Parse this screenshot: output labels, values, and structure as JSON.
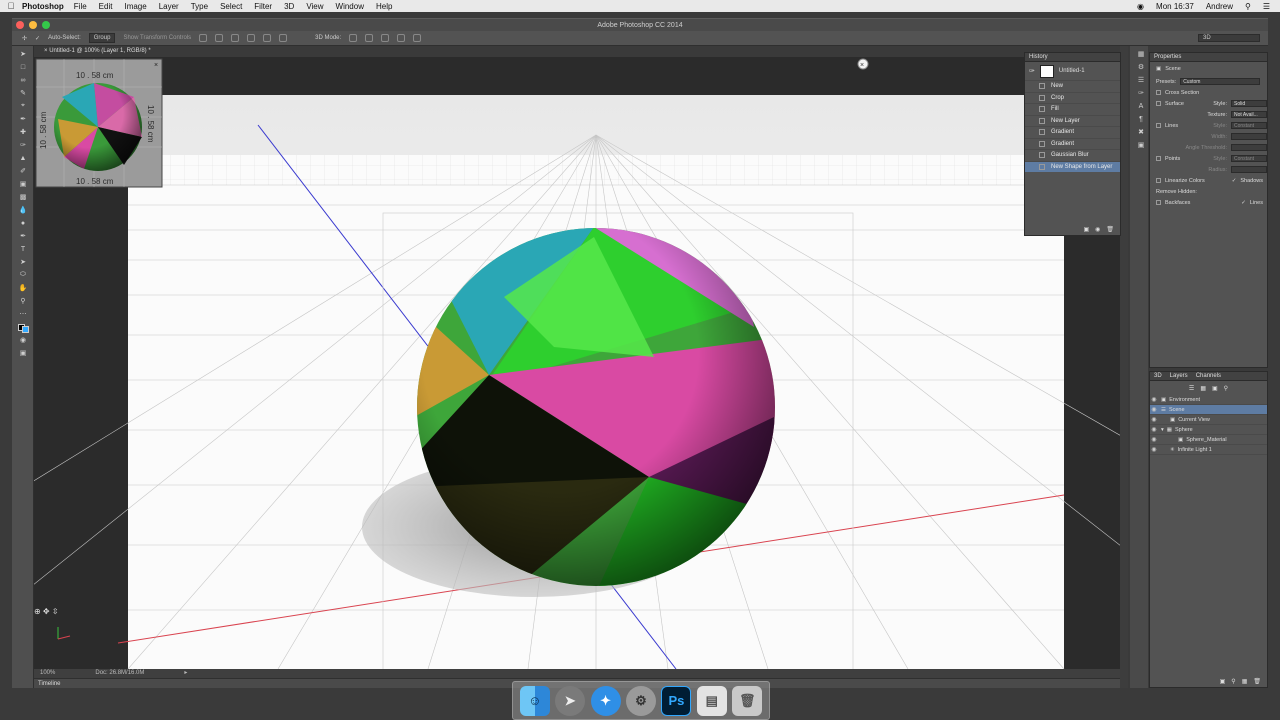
{
  "menubar": {
    "app": "Photoshop",
    "items": [
      "File",
      "Edit",
      "Image",
      "Layer",
      "Type",
      "Select",
      "Filter",
      "3D",
      "View",
      "Window",
      "Help"
    ],
    "clock": "Mon 16:37",
    "user": "Andrew"
  },
  "window": {
    "title": "Adobe Photoshop CC 2014"
  },
  "options": {
    "auto_select": "Auto-Select:",
    "group": "Group",
    "transform": "Show Transform Controls",
    "mode3d": "3D Mode:",
    "workspace": "3D"
  },
  "doc": {
    "tab": "Untitled-1 @ 100% (Layer 1, RGB/8) *",
    "zoom": "100%",
    "size": "Doc: 26.8M/16.0M",
    "ruler_top": "10 . 58 cm",
    "ruler_bottom": "10 . 58 cm",
    "ruler_left": "10 . 58 cm",
    "ruler_right": "10 . 58 cm"
  },
  "timeline": {
    "label": "Timeline"
  },
  "history": {
    "title": "History",
    "snapshot": "Untitled-1",
    "items": [
      "New",
      "Crop",
      "Fill",
      "New Layer",
      "Gradient",
      "Gradient",
      "Gaussian Blur",
      "New Shape from Layer"
    ],
    "selected_index": 7
  },
  "properties": {
    "title": "Properties",
    "scene": "Scene",
    "presets_label": "Presets:",
    "presets_value": "Custom",
    "cross_section": "Cross Section",
    "surface": "Surface",
    "style_label": "Style:",
    "style_value": "Solid",
    "texture_label": "Texture:",
    "texture_value": "Not Avail...",
    "lines": "Lines",
    "lines_style_label": "Style:",
    "lines_style_value": "Constant",
    "width_label": "Width:",
    "angle_label": "Angle Threshold:",
    "points": "Points",
    "points_style_label": "Style:",
    "points_style_value": "Constant",
    "radius_label": "Radius:",
    "linearize": "Linearize Colors",
    "shadows": "Shadows",
    "remove_hidden": "Remove Hidden:",
    "backfaces": "Backfaces",
    "lines_chk": "Lines"
  },
  "layers_panel": {
    "tabs": [
      "3D",
      "Layers",
      "Channels"
    ],
    "rows": [
      {
        "label": "Environment",
        "indent": 0
      },
      {
        "label": "Scene",
        "indent": 0
      },
      {
        "label": "Current View",
        "indent": 1
      },
      {
        "label": "Sphere",
        "indent": 1
      },
      {
        "label": "Sphere_Material",
        "indent": 2
      },
      {
        "label": "Infinite Light 1",
        "indent": 1
      }
    ],
    "selected_index": 1
  },
  "dock": {
    "ps_label": "Ps"
  },
  "colors": {
    "accent": "#5e7ca3",
    "ps_blue": "#31a8ff"
  }
}
